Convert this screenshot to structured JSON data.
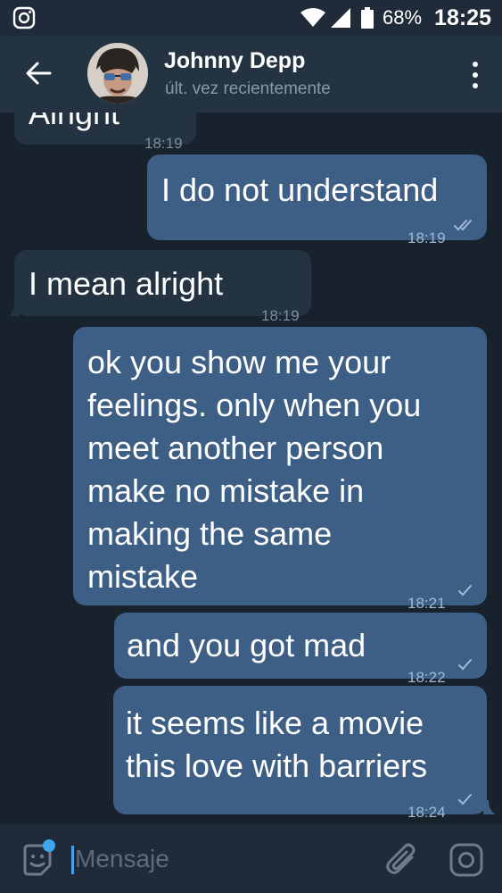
{
  "status_bar": {
    "battery_percent": "68%",
    "time": "18:25",
    "icons": [
      "instagram-icon",
      "wifi-icon",
      "signal-icon",
      "battery-icon"
    ]
  },
  "header": {
    "contact_name": "Johnny Depp",
    "contact_status": "últ. vez recientemente",
    "icons": [
      "back-arrow-icon",
      "avatar",
      "more-vertical-icon"
    ]
  },
  "messages": [
    {
      "direction": "in",
      "text": "Alright",
      "time": "18:19"
    },
    {
      "direction": "out",
      "text": "I do not understand",
      "time": "18:19",
      "status": "read"
    },
    {
      "direction": "in",
      "text": "I mean alright",
      "time": "18:19"
    },
    {
      "direction": "out",
      "text_lines": [
        "ok you show me your",
        "feelings. only when you",
        "meet another person",
        "make no mistake in",
        "making the same",
        "mistake"
      ],
      "time": "18:21",
      "status": "sent"
    },
    {
      "direction": "out",
      "text": "and you got mad",
      "time": "18:22",
      "status": "sent"
    },
    {
      "direction": "out",
      "text_lines": [
        "it seems like a movie",
        "this love with barriers"
      ],
      "time": "18:24",
      "status": "sent"
    }
  ],
  "input_bar": {
    "placeholder": "Mensaje",
    "icons": [
      "sticker-icon",
      "paperclip-icon",
      "camera-icon"
    ]
  },
  "colors": {
    "background": "#18222d",
    "header": "#243342",
    "incoming_bubble": "#243342",
    "outgoing_bubble": "#3e5f85",
    "accent": "#3fa6ef"
  }
}
